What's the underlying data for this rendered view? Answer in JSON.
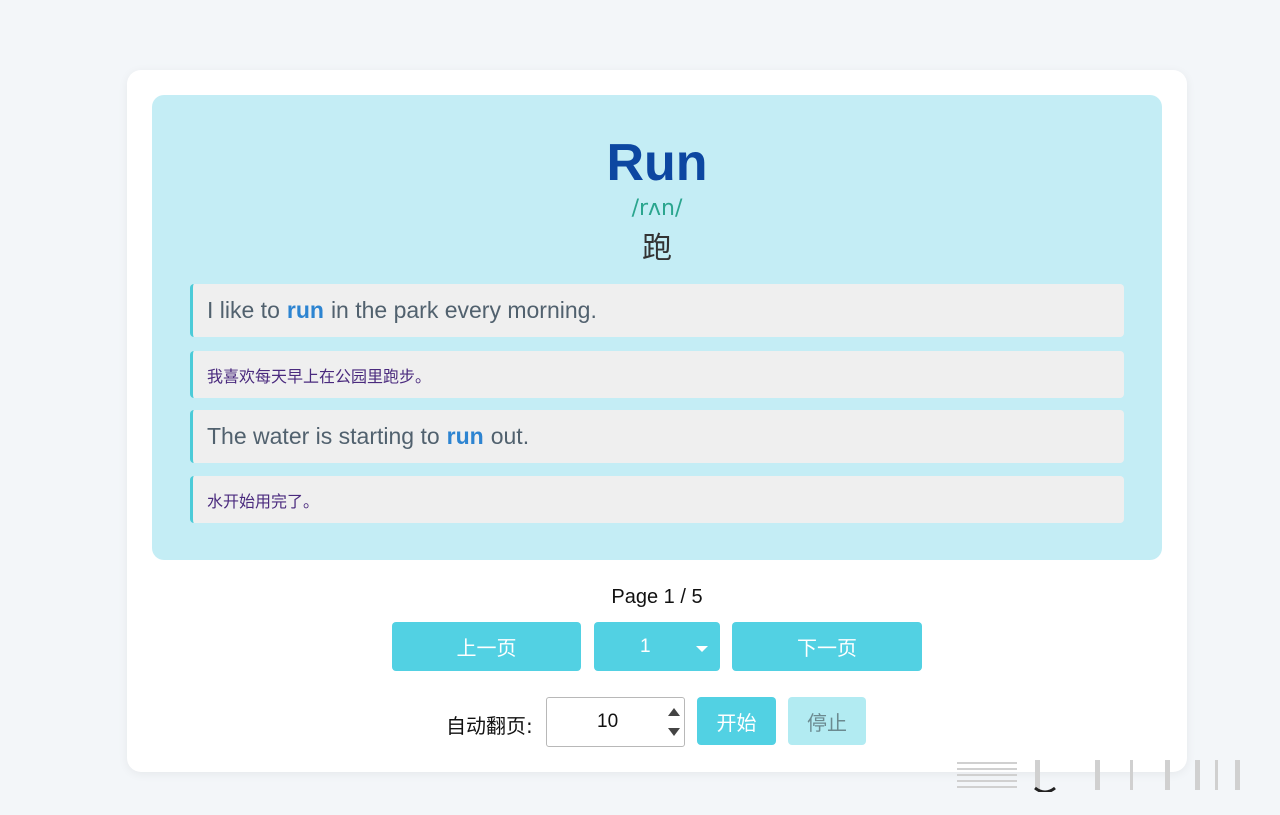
{
  "word": {
    "headword": "Run",
    "phonetic": "/rʌn/",
    "translation": "跑"
  },
  "examples": [
    {
      "en_before": "I like to",
      "en_highlight": "run",
      "en_after": "in the park every morning.",
      "zh": "我喜欢每天早上在公园里跑步。"
    },
    {
      "en_before": "The water is starting to",
      "en_highlight": "run",
      "en_after": "out.",
      "zh": "水开始用完了。"
    }
  ],
  "pagination": {
    "indicator": "Page 1 / 5",
    "prev_label": "上一页",
    "next_label": "下一页",
    "selected_page": "1"
  },
  "autoplay": {
    "label": "自动翻页:",
    "interval": "10",
    "start_label": "开始",
    "stop_label": "停止"
  },
  "colors": {
    "card_bg": "#c4edf5",
    "headword": "#0d47a1",
    "phonetic": "#2aa58e",
    "highlight": "#2d84d1",
    "button": "#52d1e3",
    "button_disabled": "#b2ebf2"
  }
}
